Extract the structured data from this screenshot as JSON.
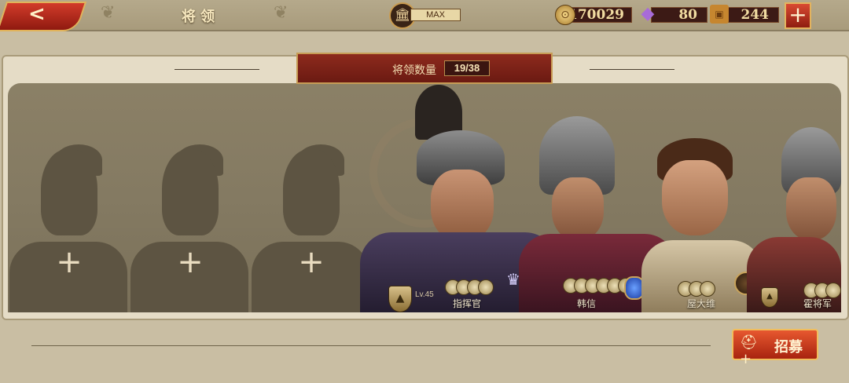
{
  "header": {
    "back_icon": "back-arrow-icon",
    "title": "将领",
    "building_level": "MAX",
    "building_icon": "temple-icon"
  },
  "resources": [
    {
      "name": "gold",
      "icon": "coin-icon",
      "value": "170029"
    },
    {
      "name": "gems",
      "icon": "gem-icon",
      "value": "80"
    },
    {
      "name": "crates",
      "icon": "crate-icon",
      "value": "244"
    }
  ],
  "add_button_icon": "plus-icon",
  "roster": {
    "count_label": "将领数量",
    "count_value": "19/38",
    "empty_slots": 3,
    "generals": [
      {
        "name": "指挥官",
        "level": "Lv.45",
        "coins": 4
      },
      {
        "name": "韩信",
        "coins": 6
      },
      {
        "name": "屋大维",
        "coins": 3
      },
      {
        "name": "霍将军",
        "coins": 3
      }
    ]
  },
  "recruit": {
    "label": "招募",
    "icon": "helmet-plus-icon"
  },
  "colors": {
    "accent_red": "#8f1a10",
    "gold_border": "#e1b35a",
    "panel_bg": "#847a62"
  }
}
